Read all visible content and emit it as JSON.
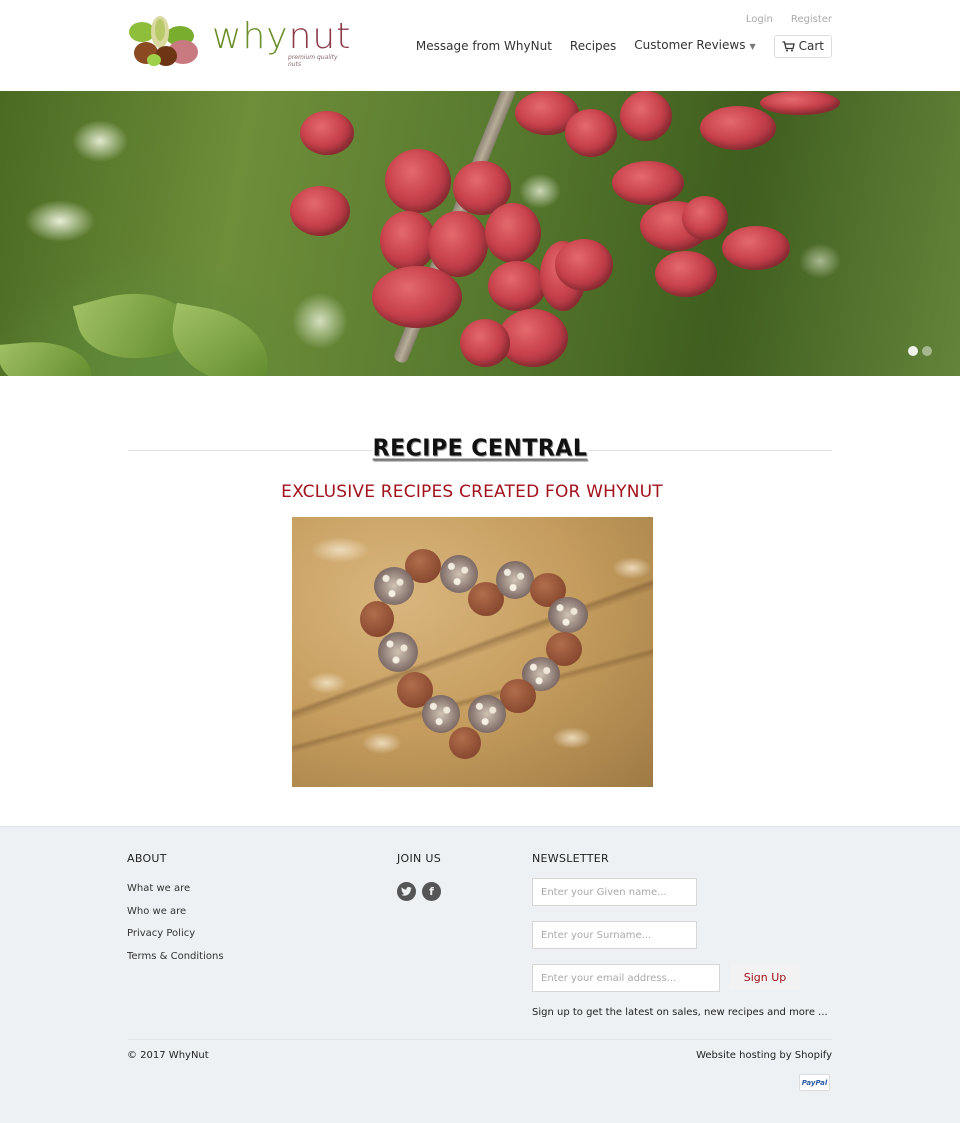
{
  "header": {
    "logo": {
      "word_part1": "why",
      "word_part2": "nut",
      "tagline": "premium quality nuts"
    },
    "account_links": [
      "Login",
      "Register"
    ],
    "nav": [
      {
        "label": "Message from WhyNut",
        "has_dropdown": false
      },
      {
        "label": "Recipes",
        "has_dropdown": false
      },
      {
        "label": "Customer Reviews",
        "has_dropdown": true
      }
    ],
    "cart_label": "Cart",
    "dropdown_glyph": "▼"
  },
  "hero": {
    "image_subject": "pistachios on branch",
    "slides_total": 2,
    "active_slide": 1
  },
  "main": {
    "title": "RECIPE CENTRAL",
    "subtitle": "EXCLUSIVE RECIPES CREATED FOR WHYNUT",
    "image_subject": "heart of nut and cocoa truffles"
  },
  "footer": {
    "about": {
      "heading": "ABOUT",
      "links": [
        "What we are",
        "Who we are",
        "Privacy Policy",
        "Terms & Conditions"
      ]
    },
    "join": {
      "heading": "JOIN US",
      "social": [
        {
          "name": "twitter",
          "glyph": "t"
        },
        {
          "name": "facebook",
          "glyph": "f"
        }
      ]
    },
    "newsletter": {
      "heading": "NEWSLETTER",
      "given_name_placeholder": "Enter your Given name...",
      "surname_placeholder": "Enter your Surname...",
      "email_placeholder": "Enter your email address...",
      "signup_label": "Sign Up",
      "blurb": "Sign up to get the latest on sales, new recipes and more ..."
    },
    "copyright": "© 2017 WhyNut",
    "hosting": "Website hosting by Shopify",
    "payment_badge": "PayPal"
  },
  "colors": {
    "accent_red": "#a3121c",
    "footer_bg": "#edf1f3",
    "logo_green": "#6c8f2a",
    "logo_maroon": "#8c3a4a"
  }
}
